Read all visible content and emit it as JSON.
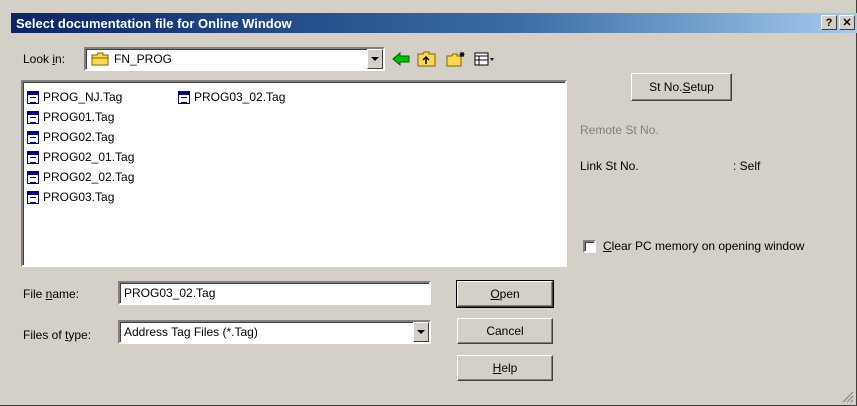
{
  "window": {
    "title": "Select documentation file for Online Window",
    "help_glyph": "?",
    "close_glyph": "✕"
  },
  "lookin": {
    "label_pre": "Look ",
    "label_u": "i",
    "label_post": "n:",
    "folder": "FN_PROG"
  },
  "toolbar": {
    "back_icon": "back-arrow-icon",
    "up_icon": "up-folder-icon",
    "newfolder_icon": "new-folder-icon",
    "view_icon": "view-menu-icon"
  },
  "files": [
    "PROG_NJ.Tag",
    "PROG01.Tag",
    "PROG02.Tag",
    "PROG02_01.Tag",
    "PROG02_02.Tag",
    "PROG03.Tag",
    "PROG03_02.Tag"
  ],
  "filename": {
    "label_pre": "File ",
    "label_u": "n",
    "label_post": "ame:",
    "value": "PROG03_02.Tag"
  },
  "filetype": {
    "label_pre": "Files of ",
    "label_u": "t",
    "label_post": "ype:",
    "value": "Address Tag Files (*.Tag)"
  },
  "buttons": {
    "open_u": "O",
    "open_rest": "pen",
    "cancel": "Cancel",
    "help_u": "H",
    "help_rest": "elp",
    "stno_pre": "St No. ",
    "stno_u": "S",
    "stno_rest": "etup"
  },
  "right_panel": {
    "remote_label": "Remote St No.",
    "link_label": "Link St No.",
    "link_value": ": Self",
    "clear_u": "C",
    "clear_rest": "lear PC memory on opening window"
  }
}
